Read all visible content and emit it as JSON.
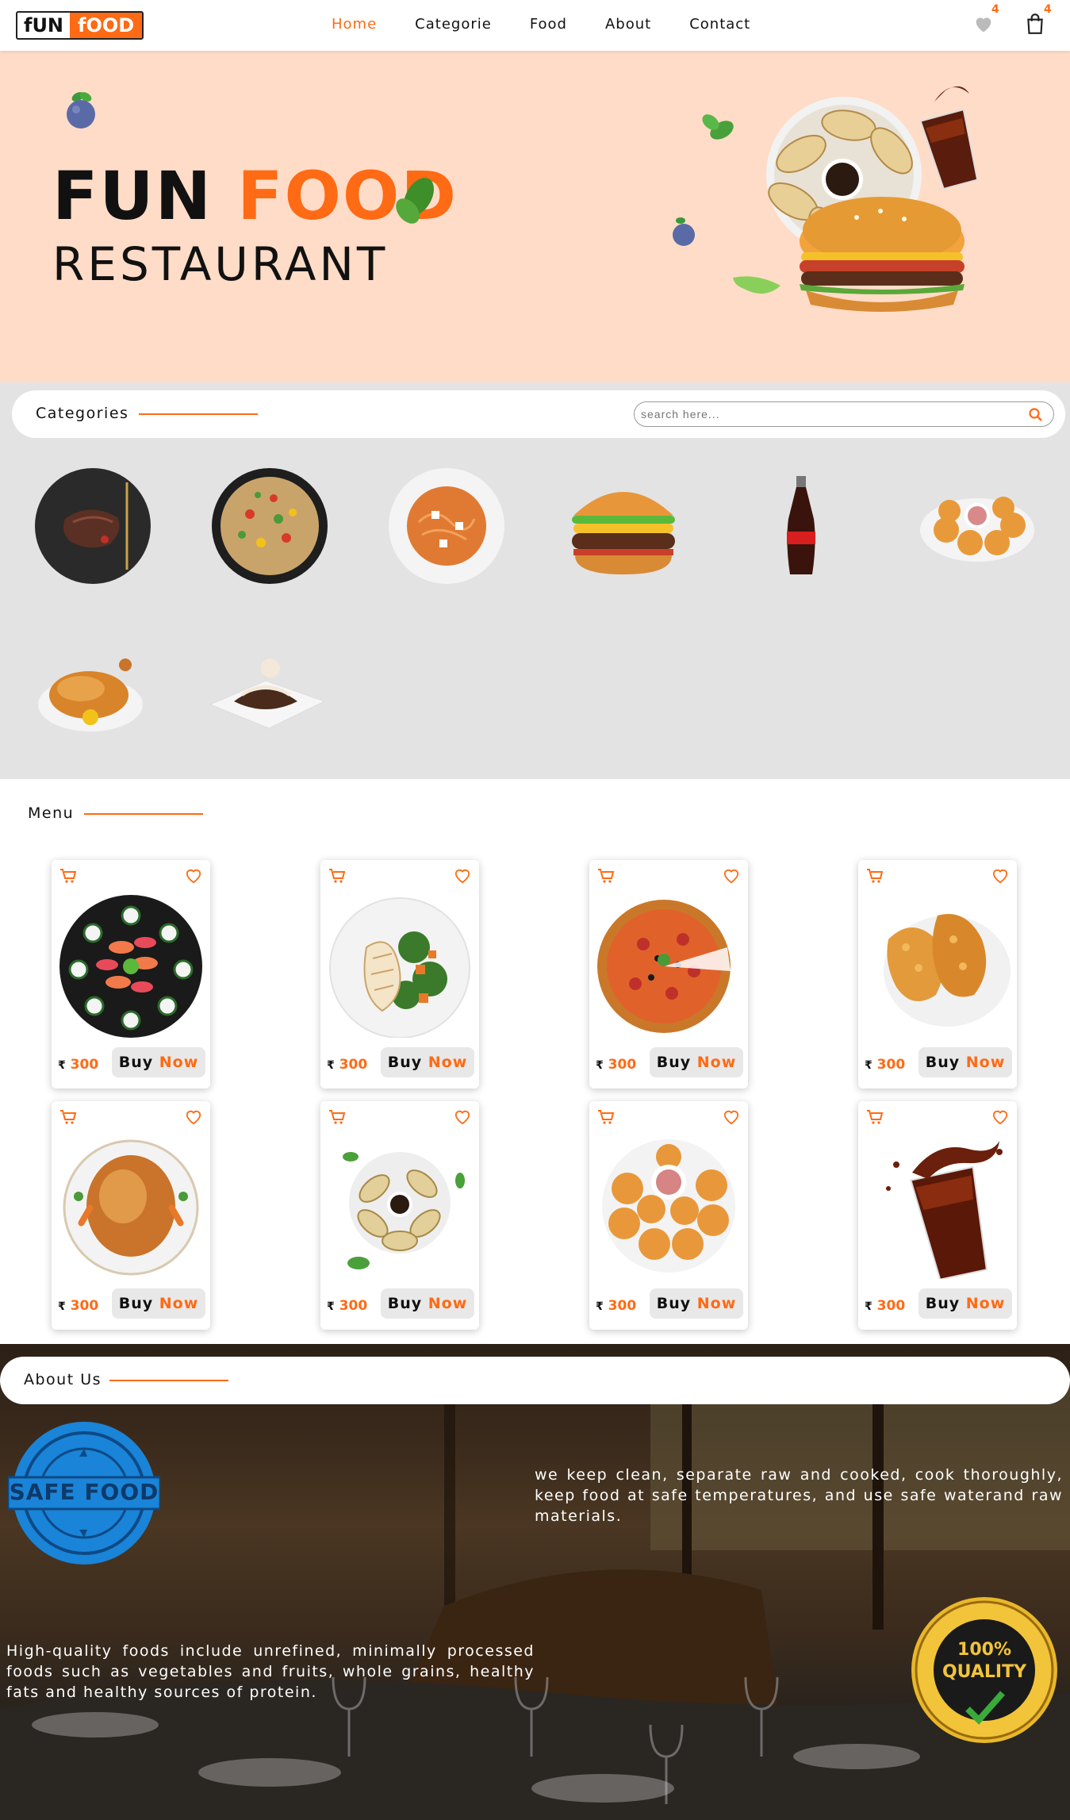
{
  "nav": {
    "logo_left": "fUN",
    "logo_right": "fOOD",
    "items": [
      "Home",
      "Categorie",
      "Food",
      "About",
      "Contact"
    ],
    "active_index": 0,
    "wishlist_count": "4",
    "cart_count": "4"
  },
  "hero": {
    "title_dark": "FUN",
    "title_accent": "FOOD",
    "subtitle": "RESTAURANT"
  },
  "categories": {
    "title": "Categories",
    "search_placeholder": "search here...",
    "items": [
      "steak",
      "stir-fry noodles",
      "pasta",
      "burger",
      "cola bottle",
      "chicken nuggets",
      "roast chicken",
      "chocolate dessert"
    ]
  },
  "menu": {
    "title": "Menu",
    "currency": "₹",
    "buy_label_1": "Buy",
    "buy_label_2": "Now",
    "items": [
      {
        "food": "sushi platter",
        "price": "300"
      },
      {
        "food": "grilled chicken salad",
        "price": "300"
      },
      {
        "food": "pizza",
        "price": "300"
      },
      {
        "food": "fried chicken",
        "price": "300"
      },
      {
        "food": "roast chicken",
        "price": "300"
      },
      {
        "food": "dumplings",
        "price": "300"
      },
      {
        "food": "chicken nuggets",
        "price": "300"
      },
      {
        "food": "cola drink",
        "price": "300"
      }
    ]
  },
  "about": {
    "title": "About Us",
    "text_right": "we keep clean, separate raw and cooked, cook thoroughly, keep food at safe temperatures, and use safe waterand raw materials.",
    "text_left": "High-quality foods include unrefined, minimally processed foods such as vegetables and fruits, whole grains, healthy fats and healthy sources of protein.",
    "stamp_text": "SAFE FOOD",
    "seal_text": "100% QUALITY"
  },
  "colors": {
    "accent": "#ff6a14",
    "hero_bg": "#ffdcc7",
    "category_bg": "#e3e3e3"
  }
}
